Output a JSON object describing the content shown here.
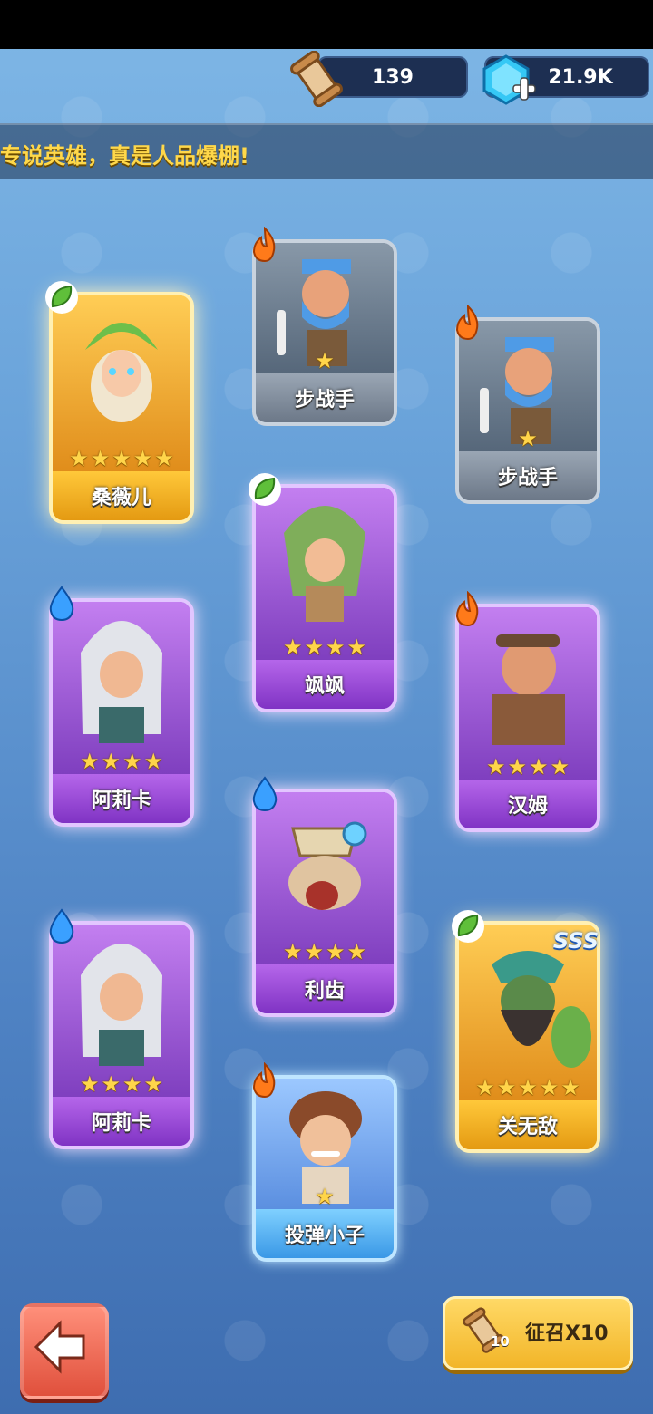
{
  "resources": {
    "scrolls": "139",
    "gems": "21.9K"
  },
  "banner": {
    "text": "专说英雄，真是人品爆棚!"
  },
  "icons": {
    "scroll": "scroll-icon",
    "gem": "gem-plus-icon",
    "fire": "fire-element-icon",
    "leaf": "leaf-element-icon",
    "water": "water-element-icon",
    "back": "arrow-left-icon"
  },
  "cards": [
    {
      "name": "桑薇儿",
      "stars": 5,
      "rarity": "gold",
      "element": "leaf"
    },
    {
      "name": "步战手",
      "stars": 1,
      "rarity": "gray",
      "element": "fire"
    },
    {
      "name": "步战手",
      "stars": 1,
      "rarity": "gray",
      "element": "fire"
    },
    {
      "name": "飒飒",
      "stars": 4,
      "rarity": "purple",
      "element": "leaf"
    },
    {
      "name": "阿莉卡",
      "stars": 4,
      "rarity": "purple",
      "element": "water"
    },
    {
      "name": "汉姆",
      "stars": 4,
      "rarity": "purple",
      "element": "fire"
    },
    {
      "name": "利齿",
      "stars": 4,
      "rarity": "purple",
      "element": "water"
    },
    {
      "name": "阿莉卡",
      "stars": 4,
      "rarity": "purple",
      "element": "water"
    },
    {
      "name": "关无敌",
      "stars": 5,
      "rarity": "gold",
      "element": "leaf",
      "badge": "SSS"
    },
    {
      "name": "投弹小子",
      "stars": 1,
      "rarity": "blue",
      "element": "fire"
    }
  ],
  "summon": {
    "label": "征召X10",
    "count": "10"
  },
  "colors": {
    "star": "#ffd54a",
    "banner_text": "#ffd84a"
  }
}
